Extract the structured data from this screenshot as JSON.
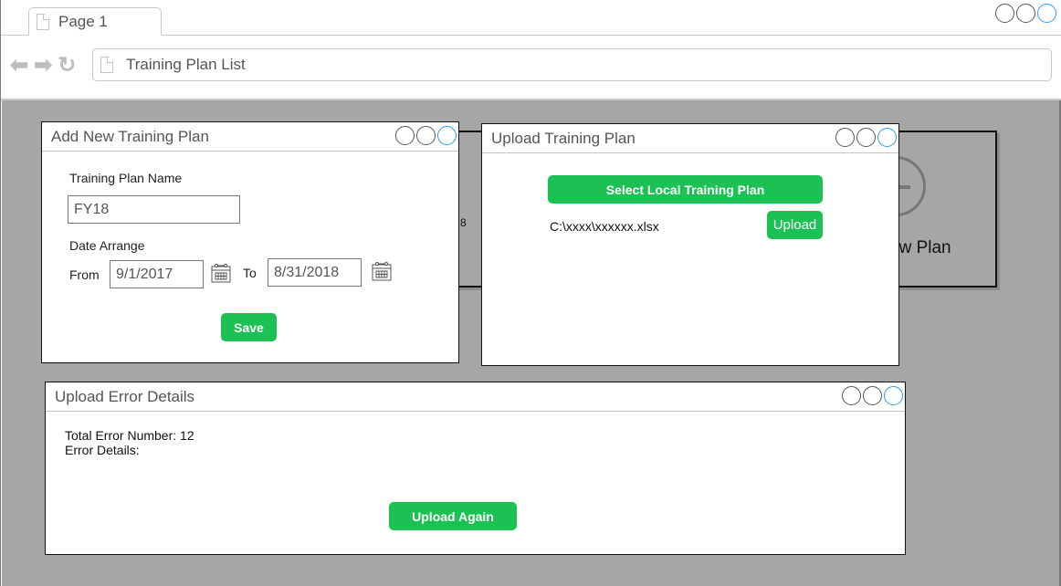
{
  "browser": {
    "tab_label": "Page 1",
    "address": "Training Plan List",
    "controls": [
      "minimize",
      "maximize",
      "close"
    ]
  },
  "background": {
    "partial_card_text": "8",
    "new_plan_card_text": "ew Plan",
    "new_plan_icon": "plus-circle-icon"
  },
  "add_plan_window": {
    "title": "Add New Training Plan",
    "name_label": "Training Plan Name",
    "name_value": "FY18",
    "date_label": "Date Arrange",
    "from_label": "From",
    "from_value": "9/1/2017",
    "to_label": "To",
    "to_value": "8/31/2018",
    "save_label": "Save"
  },
  "upload_window": {
    "title": "Upload Training Plan",
    "select_label": "Select Local Training Plan",
    "file_path": "C:\\xxxx\\xxxxxx.xlsx",
    "upload_label": "Upload"
  },
  "error_window": {
    "title": "Upload Error Details",
    "total_errors_text": "Total Error Number: 12",
    "error_details_label": "Error Details:",
    "upload_again_label": "Upload Again"
  },
  "colors": {
    "accent_green": "#1bc153",
    "window_control_blue": "#2d9bf0",
    "canvas_gray": "#a6a6a6"
  }
}
